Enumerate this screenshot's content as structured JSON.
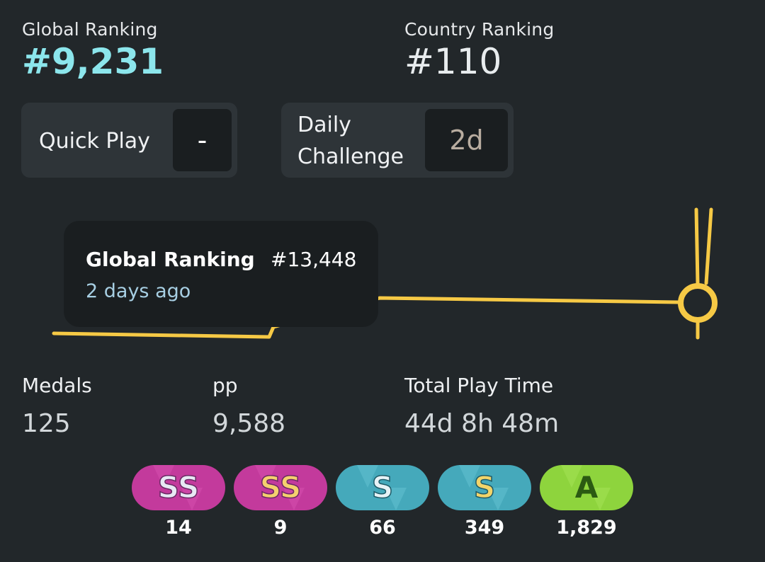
{
  "global_ranking": {
    "label": "Global Ranking",
    "value": "#9,231"
  },
  "country_ranking": {
    "label": "Country Ranking",
    "value": "#110"
  },
  "quick_play": {
    "label": "Quick Play",
    "value": "-"
  },
  "daily_challenge": {
    "label_line1": "Daily",
    "label_line2": "Challenge",
    "value": "2d"
  },
  "tooltip": {
    "title": "Global Ranking",
    "rank": "#13,448",
    "time": "2 days ago"
  },
  "medals": {
    "label": "Medals",
    "value": "125"
  },
  "pp": {
    "label": "pp",
    "value": "9,588"
  },
  "play_time": {
    "label": "Total Play Time",
    "value": "44d 8h 48m"
  },
  "grades": [
    {
      "name": "SS",
      "variant": "silver",
      "count": "14",
      "bg": "#c33a9c",
      "text_color": "#e8e8f4"
    },
    {
      "name": "SS",
      "variant": "gold",
      "count": "9",
      "bg": "#c33a9c",
      "text_color": "#f5d06e"
    },
    {
      "name": "S",
      "variant": "silver",
      "count": "66",
      "bg": "#45a9bb",
      "text_color": "#e6f2f6"
    },
    {
      "name": "S",
      "variant": "gold",
      "count": "349",
      "bg": "#45a9bb",
      "text_color": "#f2d46a"
    },
    {
      "name": "A",
      "variant": "normal",
      "count": "1,829",
      "bg": "#8ed43d",
      "text_color": "#2b5a12"
    }
  ],
  "colors": {
    "accent": "#8ce6ec",
    "graph_line": "#f6c945",
    "background": "#22272a"
  }
}
